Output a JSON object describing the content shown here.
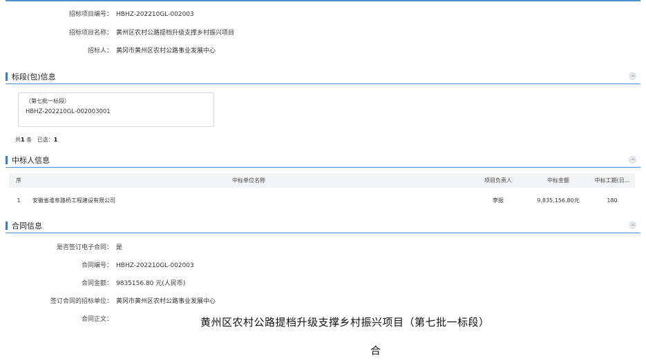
{
  "project_info": {
    "code_label": "招标项目编号：",
    "code_value": "HBHZ-202210GL-002003",
    "name_label": "招标项目名称：",
    "name_value": "黄州区农村公路提档升级支撑乡村振兴项目",
    "owner_label": "招标人：",
    "owner_value": "黄冈市黄州区农村公路事业发展中心"
  },
  "sections": {
    "lots": "标段(包)信息",
    "winners": "中标人信息",
    "contract": "合同信息"
  },
  "lot": {
    "name": "（第七批一标段）",
    "code": "HBHZ-202210GL-002003001"
  },
  "count": {
    "total_prefix": "共",
    "total": "1",
    "total_suffix": "条",
    "selected_label": "已选：",
    "selected": "1"
  },
  "winners_table": {
    "headers": [
      "序",
      "中标单位名称",
      "项目负责人",
      "中标金额",
      "中标工期(日..."
    ],
    "rows": [
      [
        "1",
        "安徽省淮阜路桥工程建设有限公司",
        "李振",
        "9,835,156.80元",
        "180"
      ]
    ]
  },
  "contract": {
    "esign_label": "是否签订电子合同：",
    "esign_value": "是",
    "code_label": "合同编号：",
    "code_value": "HBHZ-202210GL-002003",
    "amount_label": "合同金额：",
    "amount_value": "9835156.80 元(人民币)",
    "signer_label": "签订合同的招标单位：",
    "signer_value": "黄冈市黄州区农村公路事业发展中心",
    "body_label": "合同正文：",
    "body_title": "黄州区农村公路提档升级支撑乡村振兴项目（第七批一标段）",
    "body_sub": "合"
  }
}
